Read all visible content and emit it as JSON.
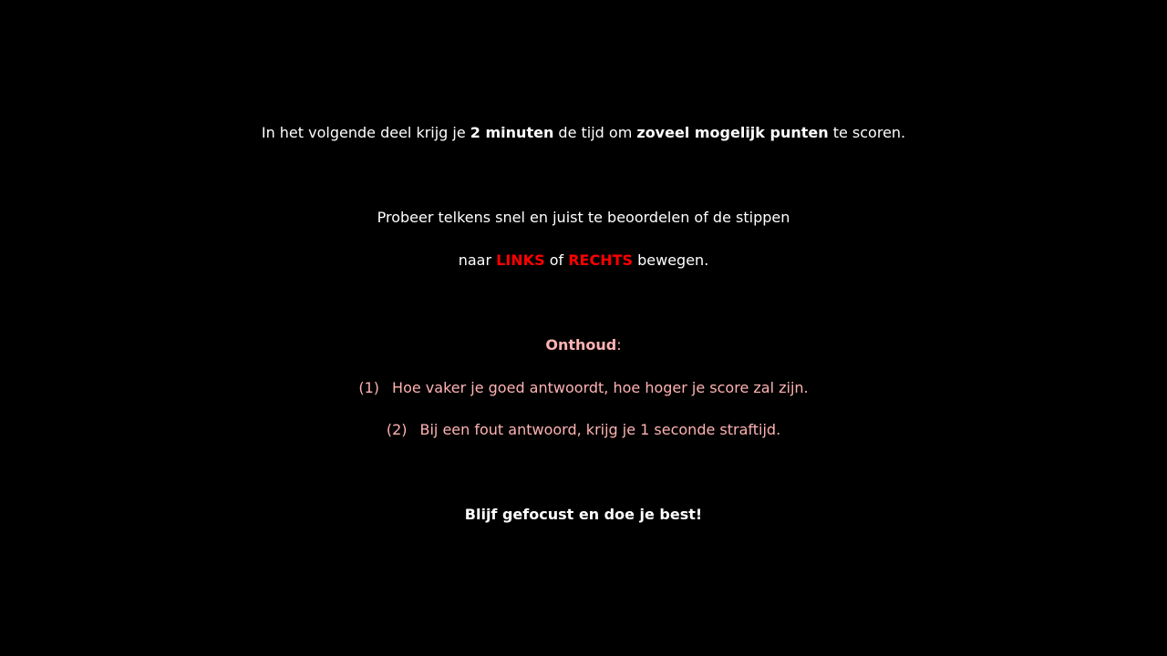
{
  "intro": {
    "part1": "In het volgende deel krijg je ",
    "duration": "2 minuten",
    "part2": " de tijd om ",
    "goal": "zoveel mogelijk punten",
    "part3": " te scoren."
  },
  "instruction": {
    "line1": "Probeer telkens snel en juist te beoordelen of de stippen",
    "line2_part1": "naar ",
    "left": "LINKS",
    "line2_part2": " of ",
    "right": "RECHTS",
    "line2_part3": " bewegen."
  },
  "reminder": {
    "heading": "Onthoud",
    "colon": ":",
    "items": [
      {
        "number": "(1)",
        "text": "Hoe vaker je goed antwoordt, hoe hoger je score zal zijn."
      },
      {
        "number": "(2)",
        "text": "Bij een fout antwoord, krijg je 1 seconde straftijd."
      }
    ]
  },
  "closing": "Blijf gefocust en doe je best!",
  "colors": {
    "background": "#000000",
    "text": "#ffffff",
    "highlight": "#ff0000",
    "reminder": "#ffb3b3"
  }
}
